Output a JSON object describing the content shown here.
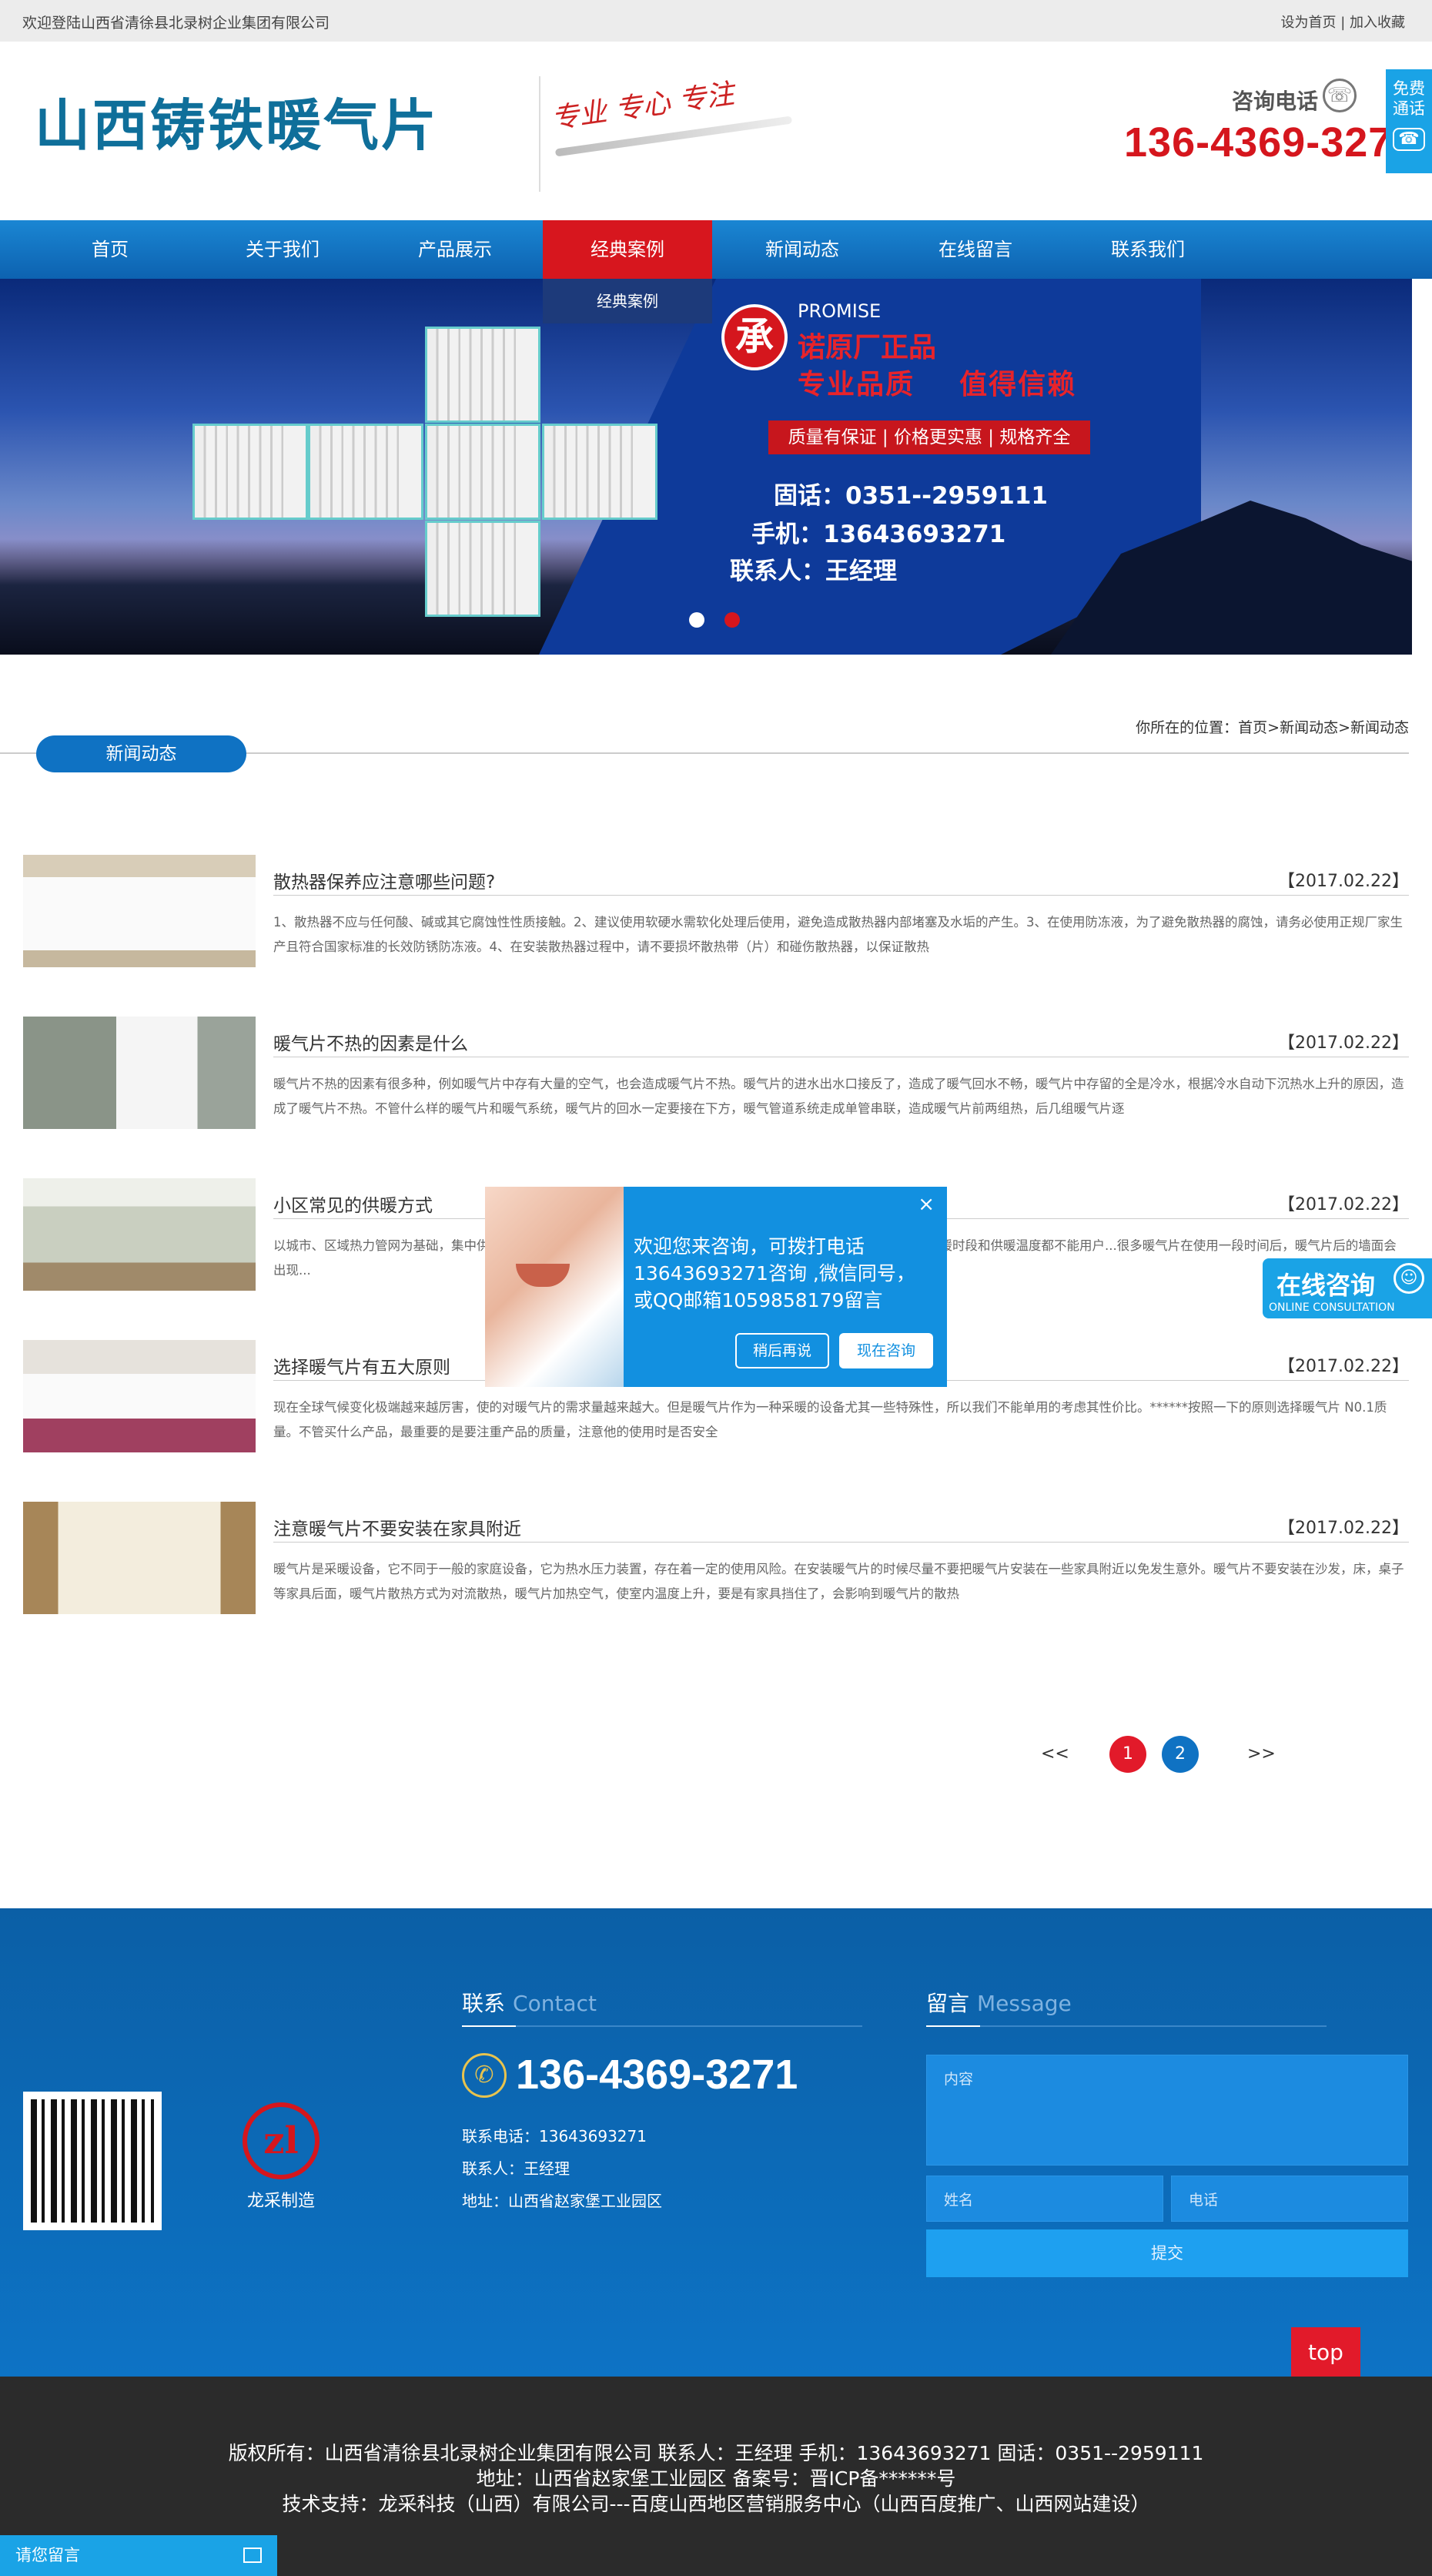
{
  "topbar": {
    "welcome": "欢迎登陆山西省清徐县北录树企业集团有限公司",
    "set_home": "设为首页",
    "sep": " | ",
    "favorite": "加入收藏"
  },
  "header": {
    "logo": "山西铸铁暖气片",
    "slogan": "专业 专心 专注",
    "consult_label": "咨询电话",
    "hotline": "136-4369-3271",
    "free_call": "免费通话"
  },
  "nav": {
    "items": [
      "首页",
      "关于我们",
      "产品展示",
      "经典案例",
      "新闻动态",
      "在线留言",
      "联系我们"
    ],
    "active_index": 3,
    "submenu_item": "经典案例"
  },
  "banner": {
    "promise_char": "承",
    "promise_en": "PROMISE",
    "promise_line1": "诺原厂正品",
    "promise_line2": "专业品质",
    "promise_line3": "值得信赖",
    "quality_tags": "质量有保证 | 价格更实惠 | 规格齐全",
    "tel": "固话：0351--2959111",
    "mobile": "手机：13643693271",
    "contact": "联系人：王经理"
  },
  "breadcrumb": {
    "label": "你所在的位置：",
    "path": "首页>新闻动态>新闻动态"
  },
  "section": {
    "tab": "新闻动态"
  },
  "news": [
    {
      "title": "散热器保养应注意哪些问题?",
      "date": "【2017.02.22】",
      "desc": "1、散热器不应与任何酸、碱或其它腐蚀性性质接触。2、建议使用软硬水需软化处理后使用，避免造成散热器内部堵塞及水垢的产生。3、在使用防冻液，为了避免散热器的腐蚀，请务必使用正规厂家生产且符合国家标准的长效防锈防冻液。4、在安装散热器过程中，请不要损坏散热带（片）和碰伤散热器，以保证散热"
    },
    {
      "title": "暖气片不热的因素是什么",
      "date": "【2017.02.22】",
      "desc": "暖气片不热的因素有很多种，例如暖气片中存有大量的空气，也会造成暖气片不热。暖气片的进水出水口接反了，造成了暖气回水不畅，暖气片中存留的全是冷水，根据冷水自动下沉热水上升的原因，造成了暖气片不热。不管什么样的暖气片和暖气系统，暖气片的回水一定要接在下方，暖气管道系统走成单管串联，造成暖气片前两组热，后几组暖气片逐"
    },
    {
      "title": "小区常见的供暖方式",
      "date": "【2017.02.22】",
      "desc": "以城市、区域热力管网为基础，集中供暖...其优势为，价格低廉，使用便捷，可以全天供暖，时间没有限制，。缺点，供暖时段和供暖温度都不能用户...很多暖气片在使用一段时间后，暖气片后的墙面会出现..."
    },
    {
      "title": "选择暖气片有五大原则",
      "date": "【2017.02.22】",
      "desc": "现在全球气候变化极端越来越厉害，使的对暖气片的需求量越来越大。但是暖气片作为一种采暖的设备尤其一些特殊性，所以我们不能单用的考虑其性价比。******按照一下的原则选择暖气片 N0.1质量。不管买什么产品，最重要的是要注重产品的质量，注意他的使用时是否安全"
    },
    {
      "title": "注意暖气片不要安装在家具附近",
      "date": "【2017.02.22】",
      "desc": "暖气片是采暖设备，它不同于一般的家庭设备，它为热水压力装置，存在着一定的使用风险。在安装暖气片的时候尽量不要把暖气片安装在一些家具附近以免发生意外。暖气片不要安装在沙发，床，桌子等家具后面，暖气片散热方式为对流散热，暖气片加热空气，使室内温度上升，要是有家具挡住了，会影响到暖气片的散热"
    }
  ],
  "pagination": {
    "prev": "<<",
    "pages": [
      "1",
      "2"
    ],
    "current": "1",
    "next": ">>"
  },
  "popup": {
    "message": "欢迎您来咨询，可拨打电话13643693271咨询 ,微信同号，或QQ邮箱1059858179留言",
    "later": "稍后再说",
    "now": "现在咨询",
    "close": "×"
  },
  "online_consult": {
    "title": "在线咨询",
    "subtitle": "ONLINE CONSULTATION"
  },
  "footer": {
    "brand_label": "龙采制造",
    "brand_mark": "zl",
    "contact_title": "联系",
    "contact_title_en": "Contact",
    "phone": "136-4369-3271",
    "tel_line": "联系电话：13643693271",
    "person_line": "联系人：王经理",
    "address_line": "地址：山西省赵家堡工业园区",
    "message_title": "留言",
    "message_title_en": "Message",
    "content_placeholder": "内容",
    "name_placeholder": "姓名",
    "phone_placeholder": "电话",
    "submit": "提交",
    "top": "top"
  },
  "copyright": {
    "line1": "版权所有：山西省清徐县北录树企业集团有限公司 联系人：王经理   手机：13643693271   固话：0351--2959111",
    "line2": "地址：山西省赵家堡工业园区 备案号：晋ICP备******号",
    "line3": "技术支持：龙采科技（山西）有限公司---百度山西地区营销服务中心（山西百度推广、山西网站建设）"
  },
  "message_bar": {
    "label": "请您留言"
  },
  "colors": {
    "nav_blue": "#0d62b0",
    "accent_red": "#d5161d",
    "footer_blue": "#0d73c5",
    "copyright_bg": "#2b2b2b"
  }
}
